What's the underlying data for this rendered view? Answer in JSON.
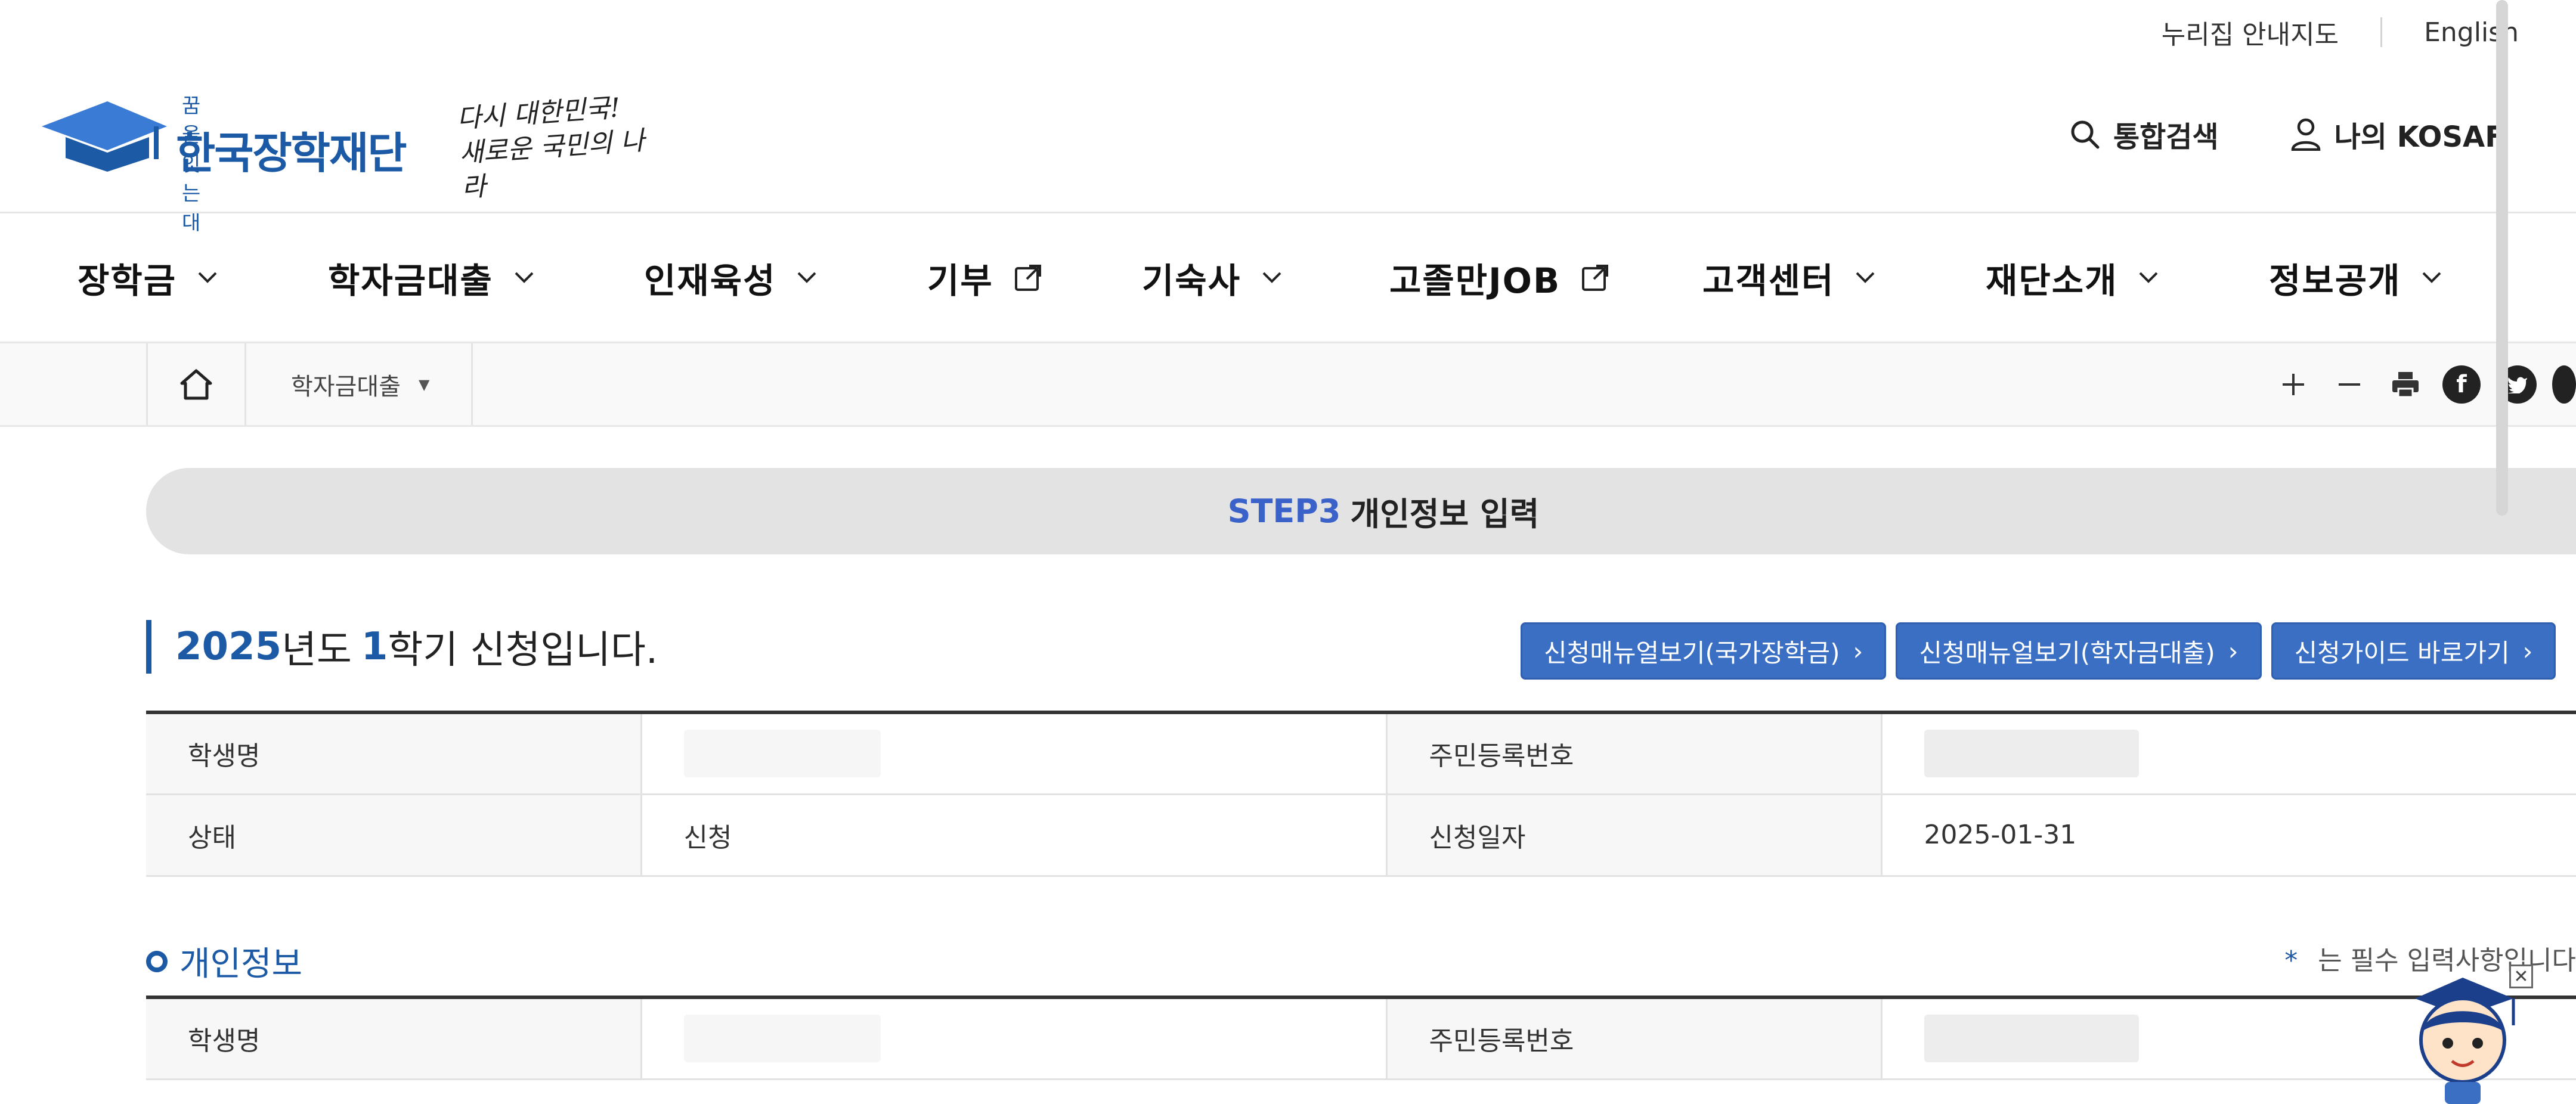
{
  "utility": {
    "sitemap": "누리집 안내지도",
    "english": "English"
  },
  "logo": {
    "sub": "꿈을 잇는 대",
    "name": "한국장학재단",
    "slogan": "다시 대한민국! 새로운 국민의 나라"
  },
  "header": {
    "search_label": "통합검색",
    "mypage_label": "나의 KOSAF"
  },
  "gnb": [
    {
      "label": "장학금",
      "type": "dropdown"
    },
    {
      "label": "학자금대출",
      "type": "dropdown"
    },
    {
      "label": "인재육성",
      "type": "dropdown"
    },
    {
      "label": "기부",
      "type": "external"
    },
    {
      "label": "기숙사",
      "type": "dropdown"
    },
    {
      "label": "고졸만JOB",
      "type": "external"
    },
    {
      "label": "고객센터",
      "type": "dropdown"
    },
    {
      "label": "재단소개",
      "type": "dropdown"
    },
    {
      "label": "정보공개",
      "type": "dropdown"
    }
  ],
  "breadcrumb": {
    "current": "학자금대출"
  },
  "step": {
    "number": "STEP3",
    "label": "개인정보 입력"
  },
  "apply": {
    "year": "2025",
    "year_suffix": "년도",
    "term": "1",
    "term_suffix": "학기 신청입니다."
  },
  "buttons": {
    "manual_national": "신청매뉴얼보기(국가장학금)",
    "manual_loan": "신청매뉴얼보기(학자금대출)",
    "guide": "신청가이드 바로가기"
  },
  "summary_table": {
    "student_name_label": "학생명",
    "student_name_value": "",
    "rrn_label": "주민등록번호",
    "status_label": "상태",
    "status_value": "신청",
    "date_label": "신청일자",
    "date_value": "2025-01-31"
  },
  "personal_info": {
    "title": "개인정보",
    "required_note": "는 필수 입력사항입니다",
    "student_name_label": "학생명",
    "rrn_label": "주민등록번호"
  },
  "colors": {
    "brand_blue": "#1c5aa6",
    "button_blue": "#3a6fc4",
    "step_blue": "#3a62c8"
  },
  "icons": {
    "search": "search-icon",
    "user": "user-icon",
    "home": "home-icon",
    "zoom_in": "plus-icon",
    "zoom_out": "minus-icon",
    "print": "print-icon",
    "facebook": "facebook-icon",
    "twitter": "twitter-icon",
    "external": "external-link-icon",
    "chevron": "chevron-down-icon"
  }
}
